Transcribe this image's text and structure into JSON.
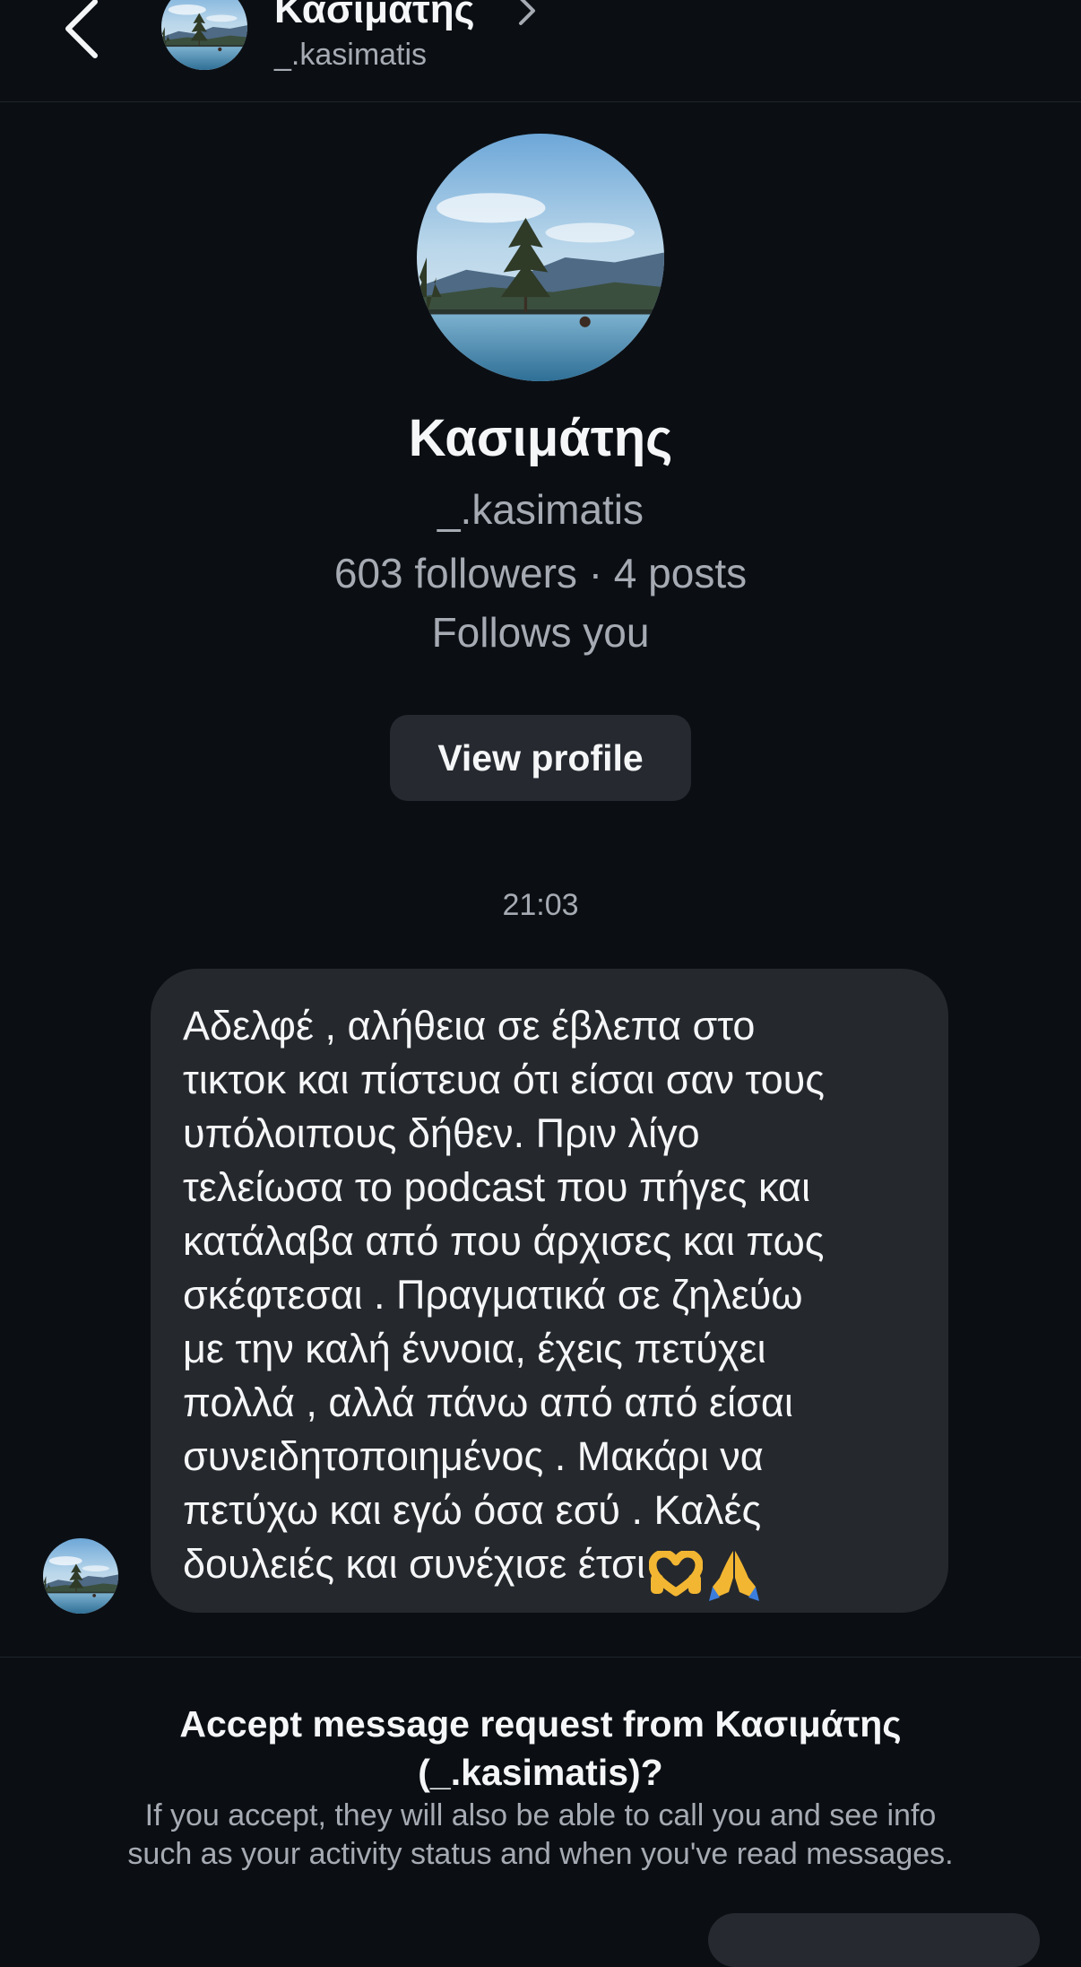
{
  "header": {
    "name": "Κασιμάτης",
    "username": "_.kasimatis",
    "icons": {
      "back": "chevron-left-icon",
      "more": "chevron-right-icon"
    }
  },
  "profile": {
    "name": "Κασιμάτης",
    "username": "_.kasimatis",
    "stats": "603 followers · 4 posts",
    "follows_you": "Follows you",
    "view_profile_label": "View profile"
  },
  "thread": {
    "timestamp": "21:03",
    "message": "Αδελφέ , αλήθεια σε έβλεπα στο\nτικτοκ και πίστευα ότι είσαι σαν τους\nυπόλοιπους  δήθεν. Πριν λίγο\nτελείωσα το podcast που πήγες και\nκατάλαβα από που άρχισες και πως\nσκέφτεσαι . Πραγματικά σε ζηλεύω\nμε την καλή έννοια, έχεις πετύχει\nπολλά , αλλά πάνω από από είσαι\nσυνειδητοποιημένος . Μακάρι να\nπετύχω και εγώ  όσα εσύ . Καλές\nδουλειές και συνέχισε έτσι",
    "emojis": [
      "heart-hands-icon",
      "folded-hands-icon"
    ]
  },
  "request": {
    "title_line1": "Accept message request from Κασιμάτης",
    "title_line2": "(_.kasimatis)?",
    "subtitle_line1": "If you accept, they will also be able to call you and see info",
    "subtitle_line2": "such as your activity status and when you've read messages."
  },
  "colors": {
    "background": "#0b0f14",
    "bubble": "#25282d",
    "button": "#262a30",
    "muted_text": "#a6abb3"
  }
}
